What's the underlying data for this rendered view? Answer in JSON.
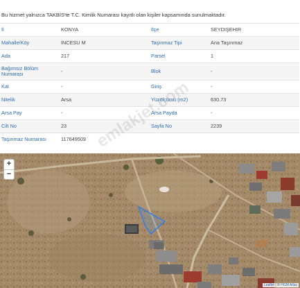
{
  "notice": "Bu hizmet yalnızca TAKBİS'te T.C. Kimlik Numarası kayıtlı olan kişiler kapsamında sunulmaktadır.",
  "rows": [
    {
      "l1": "İl",
      "v1": "KONYA",
      "l2": "İlçe",
      "v2": "SEYDİŞEHİR"
    },
    {
      "l1": "Mahalle/Köy",
      "v1": "İNCESU M",
      "l2": "Taşınmaz Tipi",
      "v2": "Ana Taşınmaz"
    },
    {
      "l1": "Ada",
      "v1": "217",
      "l2": "Parsel",
      "v2": "1"
    },
    {
      "l1": "Bağımsız Bölüm Numarası",
      "v1": "-",
      "l2": "Blok",
      "v2": "-"
    },
    {
      "l1": "Kat",
      "v1": "-",
      "l2": "Giriş",
      "v2": "-"
    },
    {
      "l1": "Nitelik",
      "v1": "Arsa",
      "l2": "Yüzölçümü (m2)",
      "v2": "630.73"
    },
    {
      "l1": "Arsa Pay",
      "v1": "-",
      "l2": "Arsa Payda",
      "v2": "-"
    },
    {
      "l1": "Cilt No",
      "v1": "23",
      "l2": "Sayfa No",
      "v2": "2239"
    },
    {
      "l1": "Taşınmaz Numarası",
      "v1": "117649509",
      "l2": "",
      "v2": ""
    }
  ],
  "map": {
    "zoom_in": "+",
    "zoom_out": "−",
    "attribution_leaflet": "Leaflet",
    "attribution_sep": " | © ",
    "attribution_source": "HGM Atlas",
    "parcel_color": "#3d7fd9"
  },
  "watermark": "emlakjet.com"
}
